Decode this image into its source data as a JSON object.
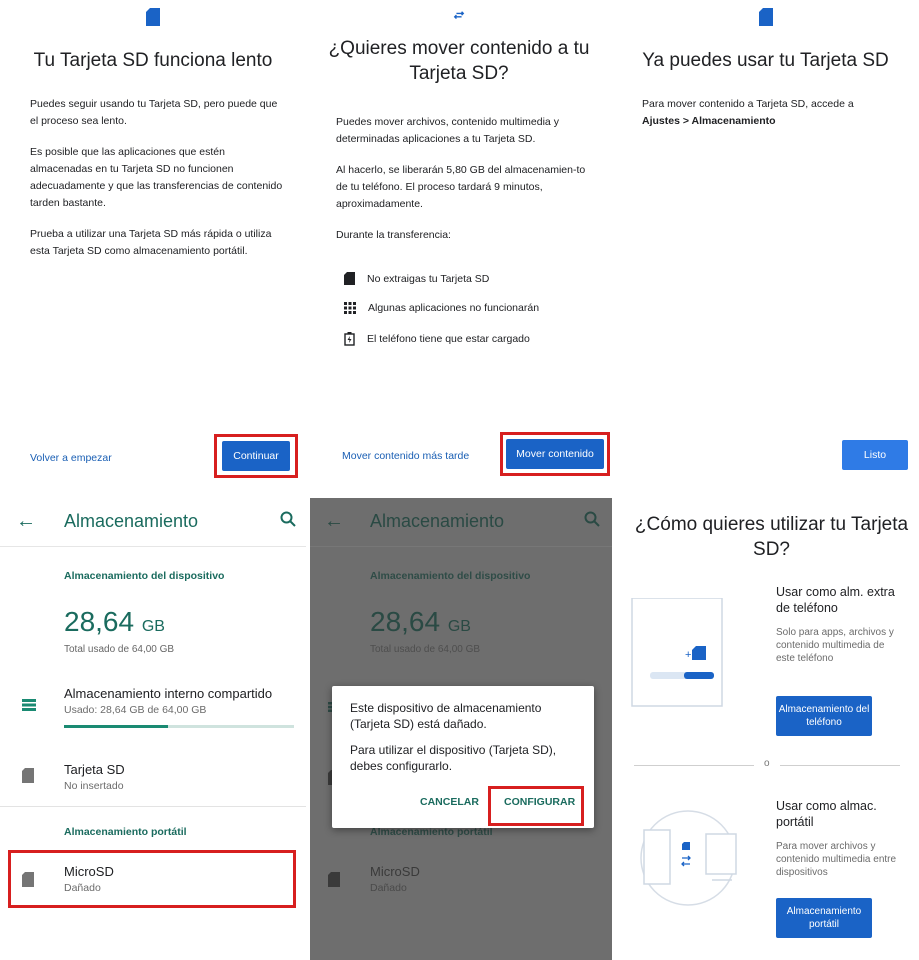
{
  "panel1": {
    "title": "Tu Tarjeta SD funciona lento",
    "p1": "Puedes seguir usando tu Tarjeta SD, pero puede que el proceso sea lento.",
    "p2": "Es posible que las aplicaciones que estén almacenadas en tu Tarjeta SD no funcionen adecuadamente y que las transferencias de contenido tarden bastante.",
    "p3": "Prueba a utilizar una Tarjeta SD más rápida o utiliza esta Tarjeta SD como almacenamiento portátil.",
    "secondary_button": "Volver a empezar",
    "primary_button": "Continuar",
    "icon": "sd-card-icon"
  },
  "panel2": {
    "title": "¿Quieres mover contenido a tu Tarjeta SD?",
    "p1": "Puedes mover archivos, contenido multimedia y determinadas aplicaciones a tu Tarjeta SD.",
    "p2": "Al hacerlo, se liberarán 5,80 GB del almacenamien-to de tu teléfono. El proceso tardará 9 minutos, aproximadamente.",
    "p3": "Durante la transferencia:",
    "items": [
      {
        "icon": "sd-card-icon",
        "text": "No extraigas tu Tarjeta SD"
      },
      {
        "icon": "apps-grid-icon",
        "text": "Algunas aplicaciones no funcionarán"
      },
      {
        "icon": "battery-charging-icon",
        "text": "El teléfono tiene que estar cargado"
      }
    ],
    "secondary_button": "Mover contenido más tarde",
    "primary_button": "Mover contenido",
    "icon": "transfer-arrows-icon"
  },
  "panel3": {
    "title": "Ya puedes usar tu Tarjeta SD",
    "p1": "Para mover contenido a Tarjeta SD, accede a",
    "p1_bold": "Ajustes > Almacenamiento",
    "primary_button": "Listo",
    "icon": "sd-card-icon"
  },
  "storage": {
    "title": "Almacenamiento",
    "device_section": "Almacenamiento del dispositivo",
    "used_value": "28,64",
    "used_unit": "GB",
    "used_total": "Total usado de 64,00 GB",
    "internal_label": "Almacenamiento interno compartido",
    "internal_sub": "Usado: 28,64 GB de 64,00 GB",
    "internal_progress": 0.45,
    "sd_label": "Tarjeta SD",
    "sd_sub": "No insertado",
    "portable_section": "Almacenamiento portátil",
    "micro_label": "MicroSD",
    "micro_sub": "Dañado"
  },
  "dialog": {
    "line1": "Este dispositivo de almacenamiento (Tarjeta SD) está dañado.",
    "line2": "Para utilizar el dispositivo (Tarjeta SD), debes configurarlo.",
    "cancel": "CANCELAR",
    "configure": "CONFIGURAR"
  },
  "choice": {
    "title": "¿Cómo quieres utilizar tu Tarjeta SD?",
    "opt1_title": "Usar como alm. extra de teléfono",
    "opt1_desc": "Solo para apps, archivos y contenido multimedia de este teléfono",
    "opt1_button": "Almacenamiento del teléfono",
    "or": "o",
    "opt2_title": "Usar como almac. portátil",
    "opt2_desc": "Para mover archivos y contenido multimedia entre dispositivos",
    "opt2_button": "Almacenamiento portátil"
  },
  "colors": {
    "accent_blue": "#1a63c6",
    "teal": "#1a6b5e",
    "highlight_red": "#d71f1f"
  }
}
